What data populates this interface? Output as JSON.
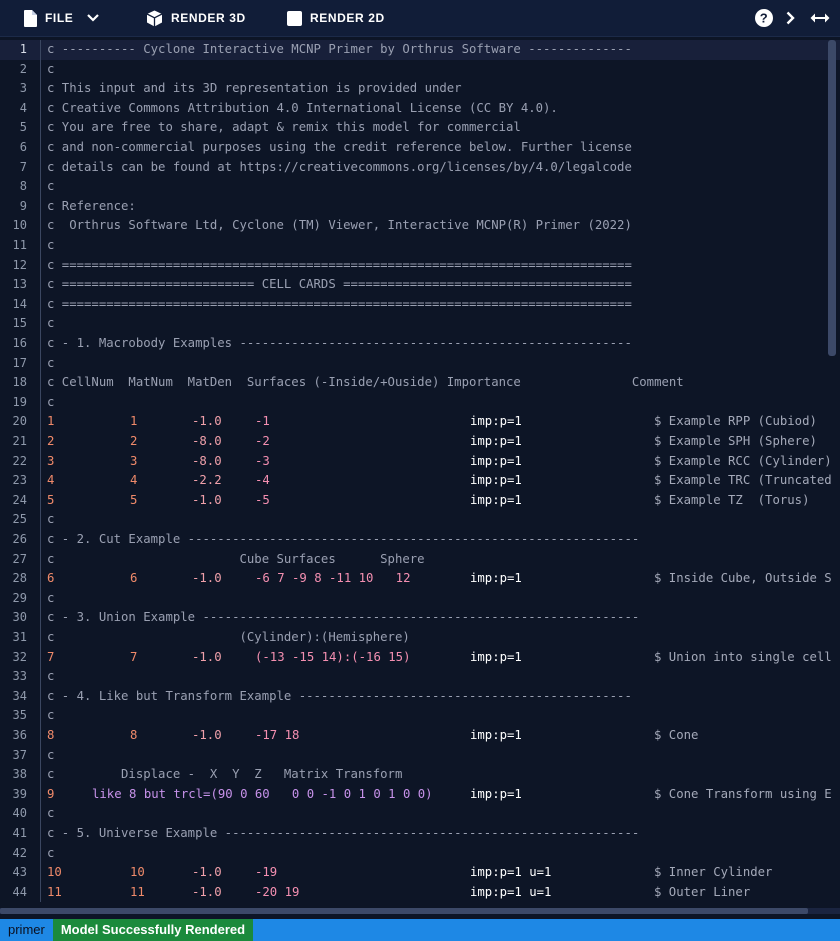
{
  "toolbar": {
    "file_label": "FILE",
    "render3d_label": "RENDER 3D",
    "render2d_label": "RENDER 2D"
  },
  "status": {
    "file": "primer",
    "message": "Model Successfully Rendered"
  },
  "lines": [
    {
      "n": "1",
      "text": "c ---------- Cyclone Interactive MCNP Primer by Orthrus Software --------------"
    },
    {
      "n": "2",
      "text": "c"
    },
    {
      "n": "3",
      "text": "c This input and its 3D representation is provided under"
    },
    {
      "n": "4",
      "text": "c Creative Commons Attribution 4.0 International License (CC BY 4.0)."
    },
    {
      "n": "5",
      "text": "c You are free to share, adapt & remix this model for commercial"
    },
    {
      "n": "6",
      "text": "c and non-commercial purposes using the credit reference below. Further license"
    },
    {
      "n": "7",
      "text": "c details can be found at https://creativecommons.org/licenses/by/4.0/legalcode"
    },
    {
      "n": "8",
      "text": "c"
    },
    {
      "n": "9",
      "text": "c Reference:"
    },
    {
      "n": "10",
      "text": "c  Orthrus Software Ltd, Cyclone (TM) Viewer, Interactive MCNP(R) Primer (2022)"
    },
    {
      "n": "11",
      "text": "c"
    },
    {
      "n": "12",
      "text": "c ============================================================================="
    },
    {
      "n": "13",
      "text": "c ========================== CELL CARDS ======================================="
    },
    {
      "n": "14",
      "text": "c ============================================================================="
    },
    {
      "n": "15",
      "text": "c"
    },
    {
      "n": "16",
      "text": "c - 1. Macrobody Examples -----------------------------------------------------"
    },
    {
      "n": "17",
      "text": "c"
    },
    {
      "n": "18",
      "text": "c CellNum  MatNum  MatDen  Surfaces (-Inside/+Ouside) Importance               Comment"
    },
    {
      "n": "19",
      "text": "c"
    },
    {
      "n": "20",
      "cell": "1",
      "mat": "1",
      "den": "-1.0",
      "surf": "-1",
      "imp": "imp:p=1",
      "cmt": "$ Example RPP (Cubiod)"
    },
    {
      "n": "21",
      "cell": "2",
      "mat": "2",
      "den": "-8.0",
      "surf": "-2",
      "imp": "imp:p=1",
      "cmt": "$ Example SPH (Sphere)"
    },
    {
      "n": "22",
      "cell": "3",
      "mat": "3",
      "den": "-8.0",
      "surf": "-3",
      "imp": "imp:p=1",
      "cmt": "$ Example RCC (Cylinder)"
    },
    {
      "n": "23",
      "cell": "4",
      "mat": "4",
      "den": "-2.2",
      "surf": "-4",
      "imp": "imp:p=1",
      "cmt": "$ Example TRC (Truncated"
    },
    {
      "n": "24",
      "cell": "5",
      "mat": "5",
      "den": "-1.0",
      "surf": "-5",
      "imp": "imp:p=1",
      "cmt": "$ Example TZ  (Torus)"
    },
    {
      "n": "25",
      "text": "c"
    },
    {
      "n": "26",
      "text": "c - 2. Cut Example -------------------------------------------------------------"
    },
    {
      "n": "27",
      "text": "c                         Cube Surfaces      Sphere"
    },
    {
      "n": "28",
      "cell": "6",
      "mat": "6",
      "den": "-1.0",
      "surf": "-6 7 -9 8 -11 10   12",
      "imp": "imp:p=1",
      "cmt": "$ Inside Cube, Outside S"
    },
    {
      "n": "29",
      "text": "c"
    },
    {
      "n": "30",
      "text": "c - 3. Union Example -----------------------------------------------------------"
    },
    {
      "n": "31",
      "text": "c                         (Cylinder):(Hemisphere)"
    },
    {
      "n": "32",
      "cell": "7",
      "mat": "7",
      "den": "-1.0",
      "surf": "(-13 -15 14):(-16 15)",
      "imp": "imp:p=1",
      "cmt": "$ Union into single cell"
    },
    {
      "n": "33",
      "text": "c"
    },
    {
      "n": "34",
      "text": "c - 4. Like but Transform Example ---------------------------------------------"
    },
    {
      "n": "35",
      "text": "c"
    },
    {
      "n": "36",
      "cell": "8",
      "mat": "8",
      "den": "-1.0",
      "surf": "-17 18",
      "imp": "imp:p=1",
      "cmt": "$ Cone"
    },
    {
      "n": "37",
      "text": "c"
    },
    {
      "n": "38",
      "text": "c         Displace -  X  Y  Z   Matrix Transform"
    },
    {
      "n": "39",
      "cell": "9",
      "like": "like 8 but trcl=(90 0 60   0 0 -1 0 1 0 1 0 0)",
      "imp": "imp:p=1",
      "cmt": "$ Cone Transform using E"
    },
    {
      "n": "40",
      "text": "c"
    },
    {
      "n": "41",
      "text": "c - 5. Universe Example --------------------------------------------------------"
    },
    {
      "n": "42",
      "text": "c"
    },
    {
      "n": "43",
      "cell": "10",
      "mat": "10",
      "den": "-1.0",
      "surf": "-19",
      "imp": "imp:p=1 u=1",
      "cmt": "$ Inner Cylinder"
    },
    {
      "n": "44",
      "cell": "11",
      "mat": "11",
      "den": "-1.0",
      "surf": "-20 19",
      "imp": "imp:p=1 u=1",
      "cmt": "$ Outer Liner"
    }
  ]
}
